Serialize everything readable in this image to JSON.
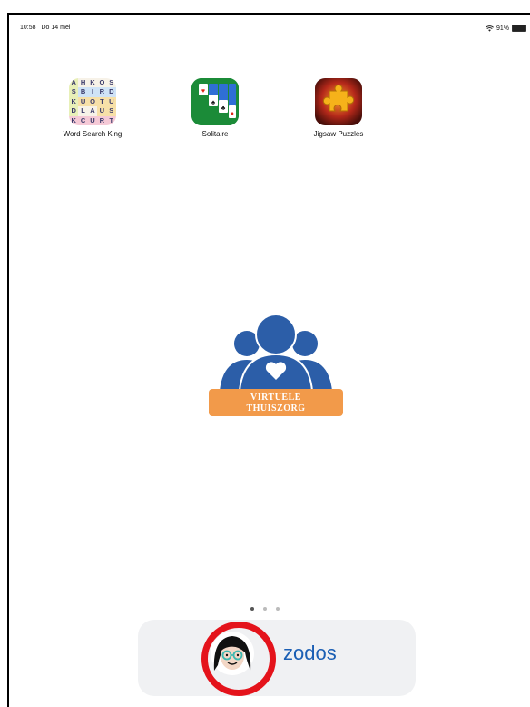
{
  "status_bar": {
    "time": "10:58",
    "date": "Do 14 mei",
    "wifi_icon": "wifi-icon",
    "battery_percent": "91%",
    "battery_level": 0.91
  },
  "apps": [
    {
      "label": "Word Search King",
      "icon": "word-search-icon",
      "grid": [
        "A",
        "H",
        "K",
        "O",
        "S",
        "S",
        "B",
        "I",
        "R",
        "D",
        "K",
        "U",
        "O",
        "T",
        "U",
        "D",
        "L",
        "A",
        "U",
        "S",
        "K",
        "C",
        "U",
        "R",
        "T"
      ]
    },
    {
      "label": "Solitaire",
      "icon": "solitaire-icon"
    },
    {
      "label": "Jigsaw Puzzles",
      "icon": "jigsaw-icon"
    }
  ],
  "center_logo": {
    "line1": "VIRTUELE",
    "line2": "THUISZORG"
  },
  "page_dots": {
    "count": 3,
    "active": 0
  },
  "dock": {
    "app1_icon": "avatar-woman-icon",
    "app2_text": "zodos"
  },
  "colors": {
    "logo_blue": "#2c5ea8",
    "logo_orange": "#f29a4a",
    "highlight_red": "#e4131b",
    "zodos_blue": "#1b5fb4"
  }
}
